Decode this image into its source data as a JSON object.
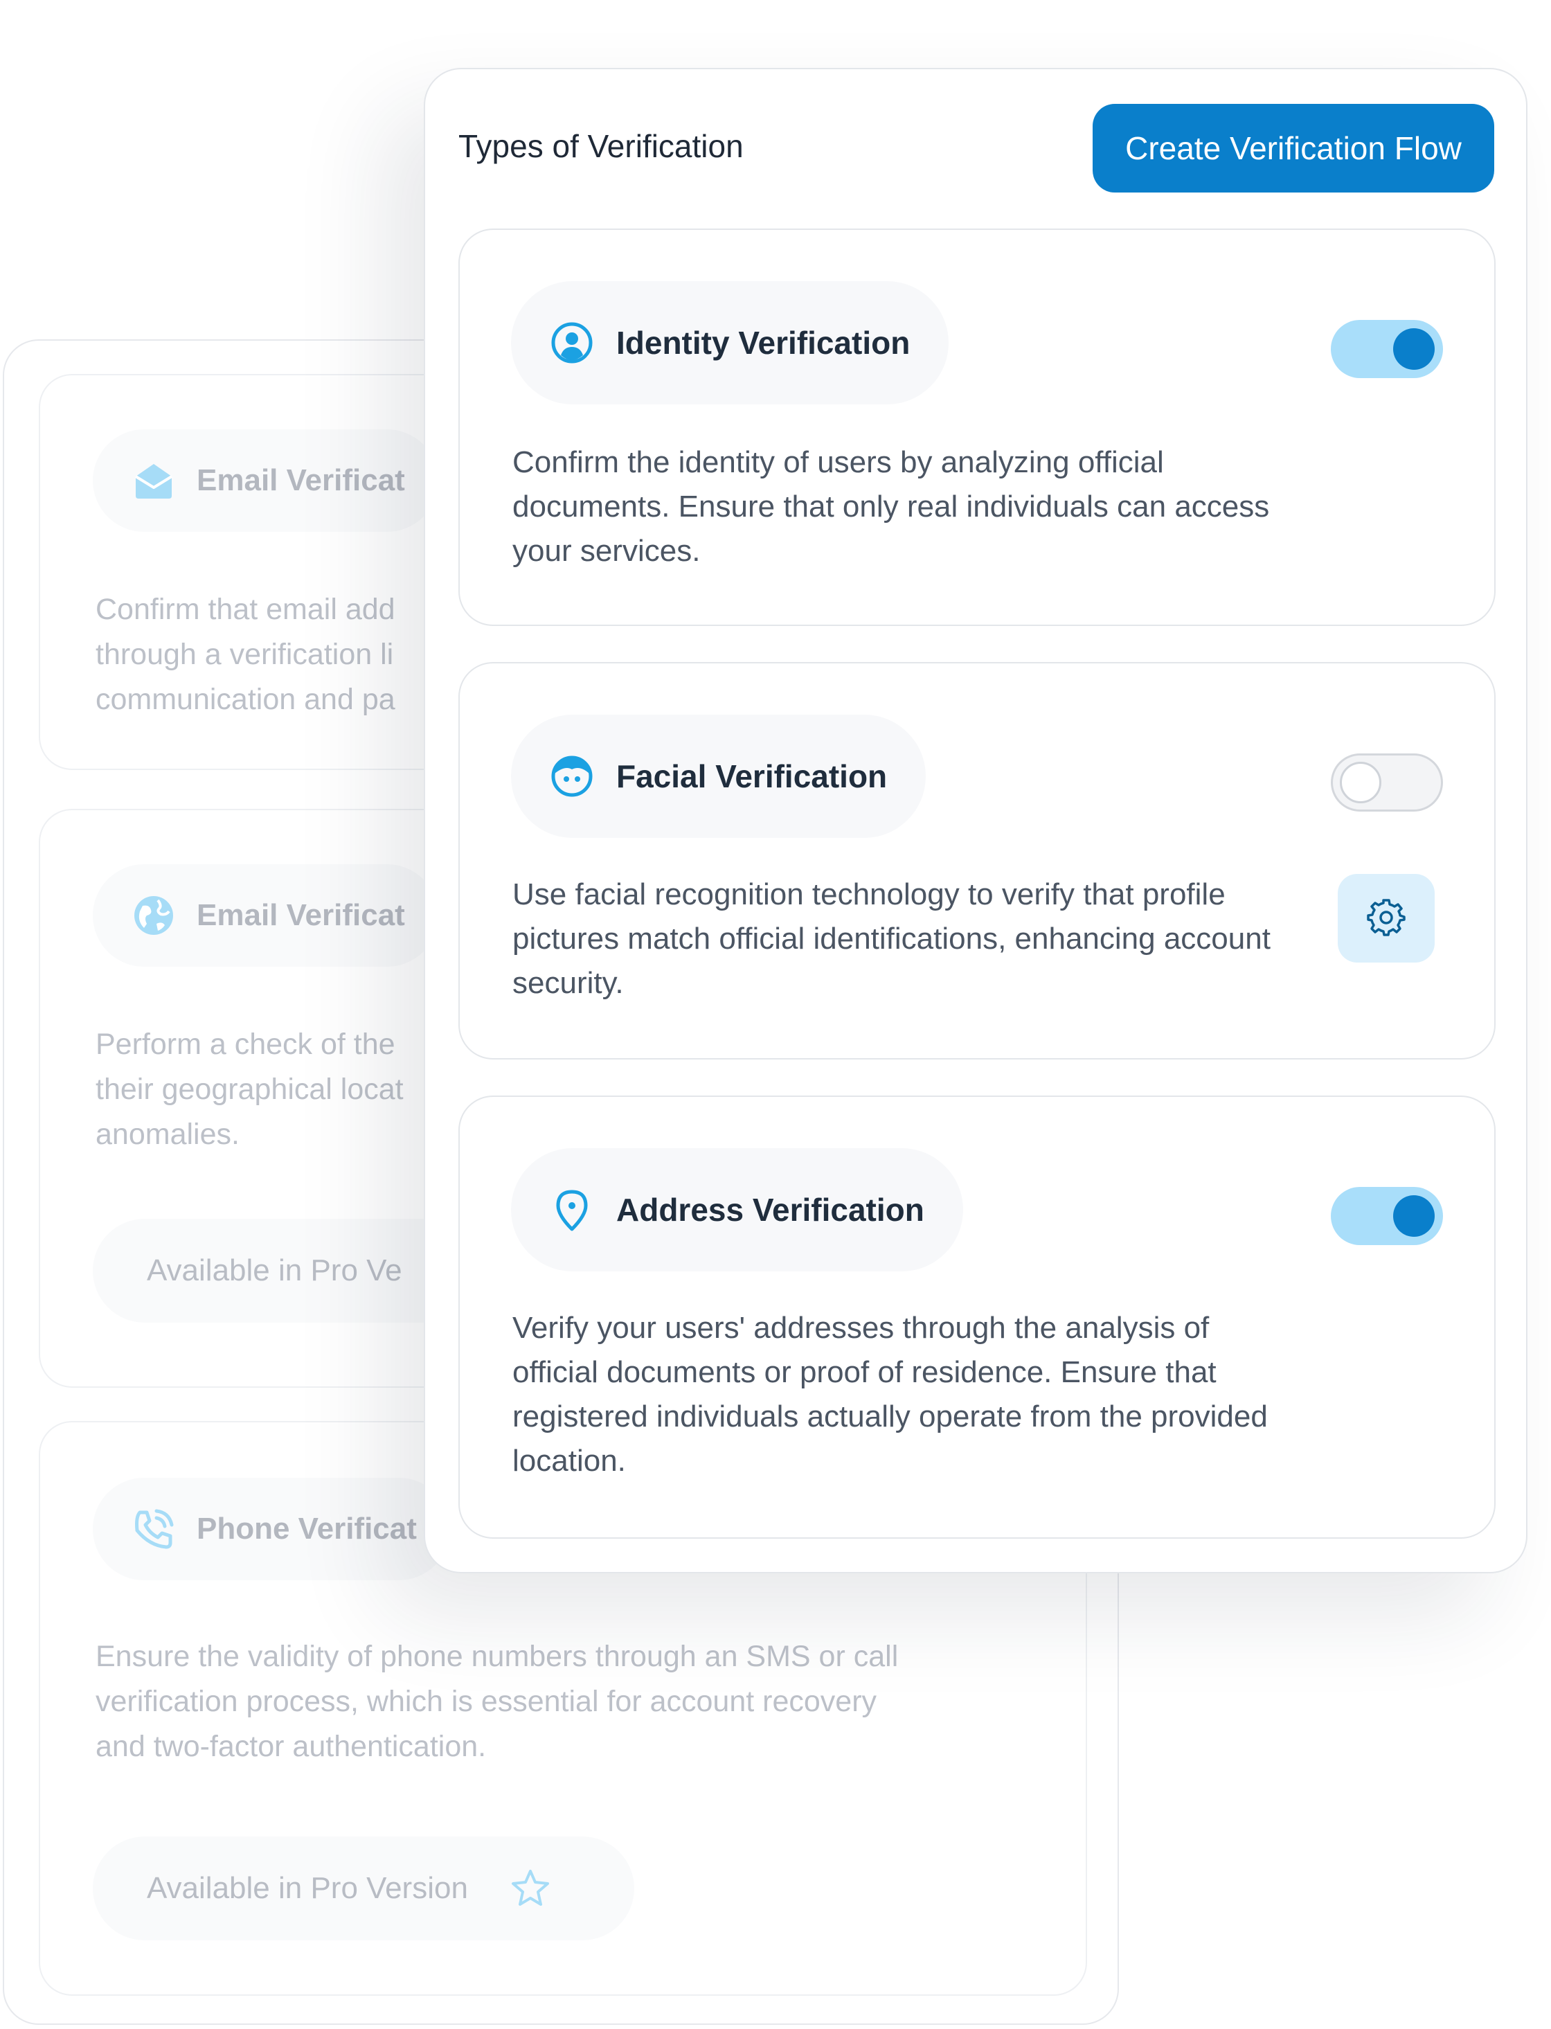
{
  "front": {
    "title": "Types of Verification",
    "create_button": "Create Verification Flow",
    "cards": [
      {
        "icon": "user-circle-icon",
        "label": "Identity Verification",
        "toggle": "on",
        "description": "Confirm the identity of users by analyzing official documents. Ensure that only real individuals can access your services."
      },
      {
        "icon": "face-icon",
        "label": "Facial Verification",
        "toggle": "off",
        "settings_icon": "gear-icon",
        "description": "Use facial recognition technology to verify that profile pictures match official identifications, enhancing account security."
      },
      {
        "icon": "location-pin-icon",
        "label": "Address Verification",
        "toggle": "on",
        "description": "Verify your users' addresses through the analysis of official documents or proof of residence. Ensure that registered individuals actually operate from the provided location."
      }
    ]
  },
  "back": {
    "cards": [
      {
        "icon": "envelope-icon",
        "label": "Email Verificat",
        "description": "Confirm that email add through a verification li communication and pa"
      },
      {
        "icon": "globe-icon",
        "label": "Email Verificat",
        "description": "Perform a check of the their geographical locat anomalies.",
        "pro_label": "Available in Pro Ve"
      },
      {
        "icon": "phone-icon",
        "label": "Phone Verificat",
        "description": "Ensure the validity of phone numbers through an SMS or call verification process, which is essential for account recovery and two-factor authentication.",
        "pro_label": "Available in Pro Version",
        "pro_icon": "star-icon"
      }
    ]
  },
  "colors": {
    "accent": "#0a7fcb",
    "toggle_on_track": "#a9defa",
    "icon_blue": "#1ba1e2"
  }
}
